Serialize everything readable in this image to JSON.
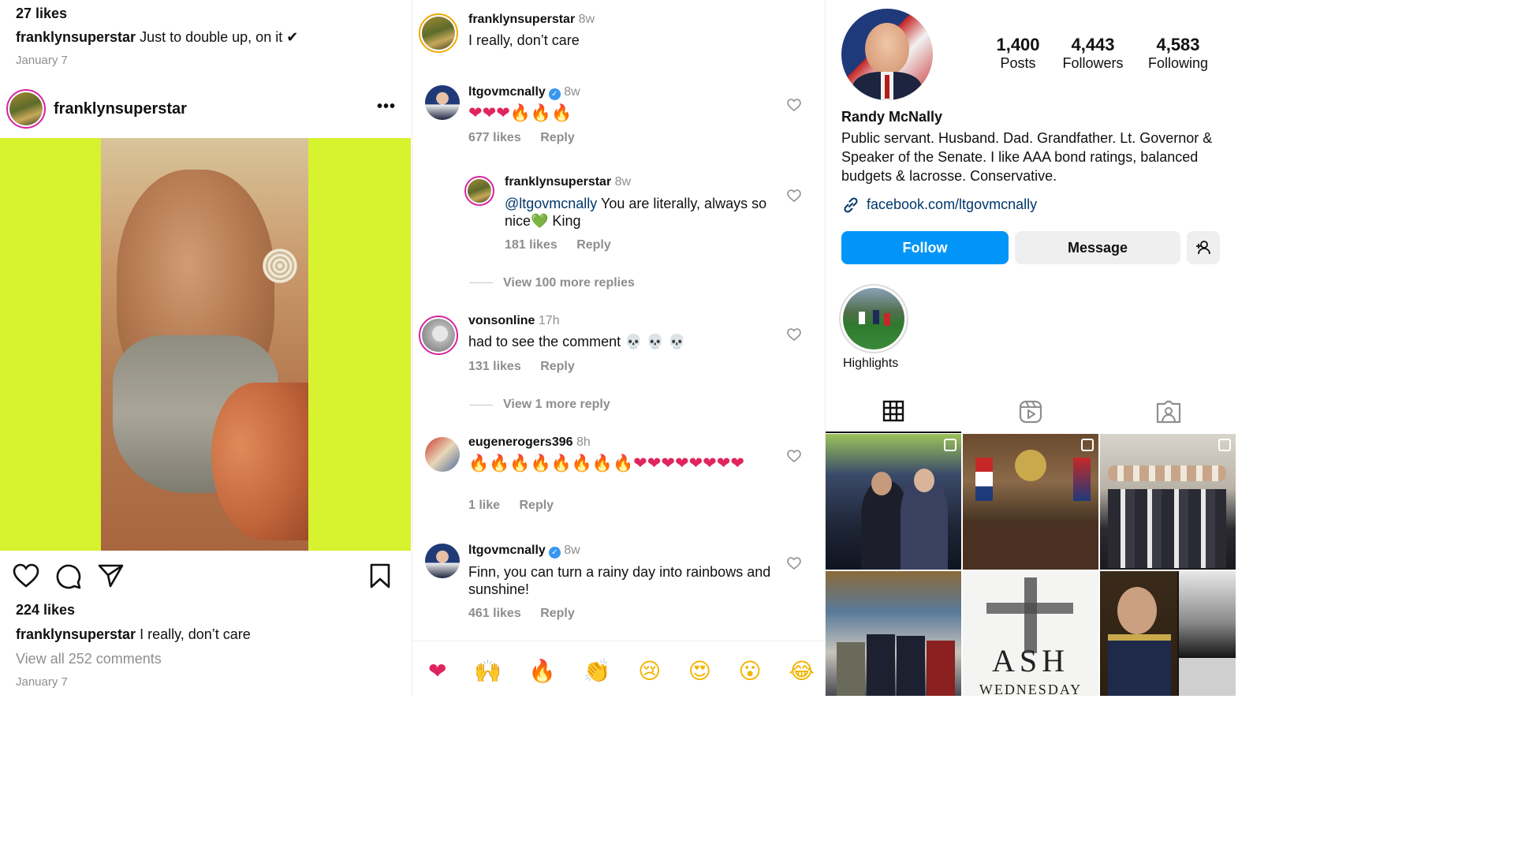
{
  "left_panel": {
    "top_likes": "27 likes",
    "top_caption_user": "franklynsuperstar",
    "top_caption_text": "Just to double up, on it ✔",
    "top_date": "January 7",
    "post_username": "franklynsuperstar",
    "more_icon": "•••",
    "post_likes": "224 likes",
    "post_caption_user": "franklynsuperstar",
    "post_caption_text": "I really, don’t care",
    "view_all_comments": "View all 252 comments",
    "post_date": "January 7",
    "colors": {
      "background_lime": "#d7f22e",
      "photo_tone": "#b07a52"
    }
  },
  "comments_panel": {
    "comments": [
      {
        "user": "franklynsuperstar",
        "time": "8w",
        "text": "I really, don’t care"
      },
      {
        "user": "ltgovmcnally",
        "time": "8w",
        "text": "❤❤❤🔥🔥🔥",
        "likes": "677 likes",
        "reply": "Reply"
      },
      {
        "user": "franklynsuperstar",
        "time": "8w",
        "mention": "@ltgovmcnally",
        "text": " You are literally, always so nice💚 King",
        "likes": "181 likes",
        "reply": "Reply"
      },
      {
        "user": "vonsonline",
        "time": "17h",
        "text": "had to see the comment 💀 💀 💀",
        "likes": "131 likes",
        "reply": "Reply"
      },
      {
        "user": "eugenerogers396",
        "time": "8h",
        "text": "🔥🔥🔥🔥🔥🔥🔥🔥❤❤❤❤❤❤❤❤",
        "likes": "1 like",
        "reply": "Reply"
      },
      {
        "user": "ltgovmcnally",
        "time": "8w",
        "text": "Finn, you can turn a rainy day into rainbows and sunshine!",
        "likes": "461 likes",
        "reply": "Reply"
      }
    ],
    "view_more_replies_1": "View 100 more replies",
    "view_more_replies_2": "View 1 more reply",
    "reaction_bar": [
      "❤",
      "🙌",
      "🔥",
      "👏",
      "😢",
      "😍",
      "😮",
      "😂"
    ]
  },
  "profile_panel": {
    "stats": [
      {
        "num": "1,400",
        "label": "Posts"
      },
      {
        "num": "4,443",
        "label": "Followers"
      },
      {
        "num": "4,583",
        "label": "Following"
      }
    ],
    "name": "Randy McNally",
    "bio": "Public servant. Husband. Dad. Grandfather. Lt. Governor & Speaker of the Senate. I like AAA bond ratings, balanced budgets & lacrosse. Conservative.",
    "link": "facebook.com/ltgovmcnally",
    "follow_label": "Follow",
    "message_label": "Message",
    "highlights_label": "Highlights",
    "grid_text_ash": "ASH",
    "grid_text_wednesday": "WEDNESDAY",
    "colors": {
      "follow_blue": "#0095f6",
      "link_blue": "#00376b"
    }
  }
}
